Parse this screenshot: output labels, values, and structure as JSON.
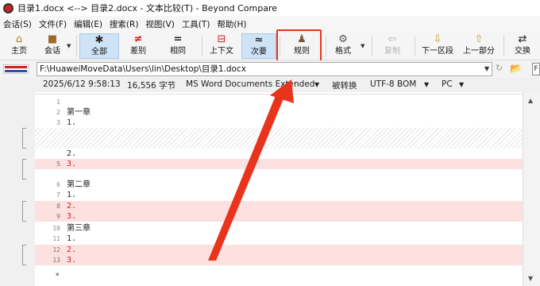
{
  "window": {
    "title": "目录1.docx <--> 目录2.docx - 文本比较(T) - Beyond Compare"
  },
  "menu": [
    {
      "label": "会话(S)"
    },
    {
      "label": "文件(F)"
    },
    {
      "label": "编辑(E)"
    },
    {
      "label": "搜索(R)"
    },
    {
      "label": "视图(V)"
    },
    {
      "label": "工具(T)"
    },
    {
      "label": "帮助(H)"
    }
  ],
  "toolbar": {
    "home": {
      "label": "主页",
      "icon": "home-icon"
    },
    "session": {
      "label": "会话",
      "icon": "briefcase-icon"
    },
    "all": {
      "label": "全部",
      "icon": "asterisk-icon"
    },
    "diff": {
      "label": "差别",
      "icon": "not-equal-icon"
    },
    "same": {
      "label": "相同",
      "icon": "equal-icon"
    },
    "context": {
      "label": "上下文",
      "icon": "context-icon"
    },
    "minor": {
      "label": "次要",
      "icon": "approx-icon"
    },
    "rules": {
      "label": "规则",
      "icon": "referee-icon"
    },
    "format": {
      "label": "格式",
      "icon": "gear-doc-icon"
    },
    "copy": {
      "label": "复制",
      "icon": "arrow-left-icon"
    },
    "next_section": {
      "label": "下一区段",
      "icon": "arrow-down-icon"
    },
    "prev_part": {
      "label": "上一部分",
      "icon": "arrow-up-icon"
    },
    "swap": {
      "label": "交换",
      "icon": "swap-icon"
    }
  },
  "path": {
    "value": "F:\\HuaweiMoveData\\Users\\lin\\Desktop\\目录1.docx"
  },
  "info": {
    "datetime": "2025/6/12 9:58:13",
    "size": "16,556 字节",
    "format": "MS Word Documents Extended",
    "conversion": "被转换",
    "encoding": "UTF-8 BOM",
    "line_ending": "PC"
  },
  "lines": [
    {
      "num": "1",
      "text": ""
    },
    {
      "num": "2",
      "text": "第一章"
    },
    {
      "num": "3",
      "text": "1."
    },
    {
      "num": "",
      "text": "2."
    },
    {
      "num": "5",
      "text": "3."
    },
    {
      "num": "6",
      "text": "第二章"
    },
    {
      "num": "7",
      "text": "1."
    },
    {
      "num": "8",
      "text": "2."
    },
    {
      "num": "9",
      "text": "3."
    },
    {
      "num": "10",
      "text": "第三章"
    },
    {
      "num": "11",
      "text": "1."
    },
    {
      "num": "12",
      "text": "2."
    },
    {
      "num": "13",
      "text": "3."
    }
  ],
  "colors": {
    "diff_bg": "#fde0e0",
    "diff_text": "#d21e1e",
    "annotation_red": "#e8341c",
    "active_button_bg": "#cfe3f7"
  }
}
